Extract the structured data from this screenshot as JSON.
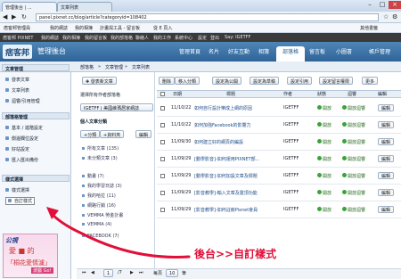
{
  "browser": {
    "tabs": [
      "管理後台 | ...",
      "文章列表"
    ],
    "url": "panel.pixnet.cc/blog/article?categoryid=108402",
    "bookmarks": [
      "痞客邦管理員",
      "我的網誌",
      "我的相簿",
      "計畫與工具 - 留言板",
      "從 E 頁入",
      "其他書籤"
    ]
  },
  "blogbar": {
    "items": [
      "痞客邦 PIXNET",
      "我的網誌",
      "我的相簿",
      "我的留言板",
      "我的部落格",
      "聯絡人",
      "我的工作",
      "系統中心",
      "設定",
      "登出",
      "Say: IGETFF"
    ]
  },
  "header": {
    "logo": "痞客邦",
    "subtitle": "管理後台",
    "tabs": [
      "管理首頁",
      "名片",
      "好友互動",
      "相簿",
      "部落格",
      "留言板",
      "小圖書",
      "帳戶管理"
    ],
    "active_tab": "部落格"
  },
  "breadcrumb": [
    "部落格",
    "文章管理",
    "文章列表"
  ],
  "sidebar": {
    "sections": [
      {
        "title": "文章管理",
        "items": [
          "發表文章",
          "文章列表",
          "迴響/引用管理"
        ]
      },
      {
        "title": "部落格管理",
        "items": [
          "基本 / 進階設定",
          "側邊欄位設定",
          "好站設定",
          "匯入匯出備份"
        ]
      },
      {
        "title": "樣式選擇",
        "items": [
          "樣式選擇",
          "自訂樣式"
        ]
      }
    ],
    "selected": "自訂樣式"
  },
  "ad": {
    "line1": "公視",
    "line2": "愛 ■ 的",
    "line3": "「桐花愛情濾」",
    "line4": "波戲 Go!"
  },
  "middle": {
    "new_button": "發表新文章",
    "select_label": "選擇所有作者部落格",
    "select_value": "IGETFF | 美國維瑪居家網誌",
    "cat_header": "個人文章分類",
    "add_button": "+分類",
    "folder_button": "+資料夾",
    "edit_button": "編輯",
    "categories": [
      "所有文章 (135)",
      "未分類文章 (3)",
      "動畫 (7)",
      "我的學習日誌 (3)",
      "我的哈拉 (11)",
      "網路行銷 (16)",
      "VEMMA 勞金計畫",
      "VEMMA (4)",
      "FACEBOOK (7)"
    ]
  },
  "toolbar": {
    "buttons": [
      "刪除",
      "移入分類",
      "設定為公開",
      "設定為草稿",
      "設定引用",
      "設定留言權限",
      "更多"
    ]
  },
  "table": {
    "headers": [
      "日期",
      "標題",
      "作者",
      "狀態",
      "迴響",
      "編輯"
    ],
    "rows": [
      {
        "date": "11/10/22",
        "title": "如何自行設計樂成上網的原因",
        "author": "IGETFF",
        "status": "開放",
        "reply": "開放迴響",
        "edit": "編輯"
      },
      {
        "date": "11/10/22",
        "title": "如何加強Facebook的影響力",
        "author": "IGETFF",
        "status": "開放",
        "reply": "開放迴響",
        "edit": "編輯"
      },
      {
        "date": "11/09/30",
        "title": "如何建立好的網頁的編設",
        "author": "IGETFF",
        "status": "開放",
        "reply": "開放迴響",
        "edit": "編輯"
      },
      {
        "date": "11/09/29",
        "title": "[動學影音]-如何運用PIXNET部...",
        "author": "IGETFF",
        "status": "開放",
        "reply": "開放迴響",
        "edit": "編輯"
      },
      {
        "date": "11/09/29",
        "title": "[動學影音]-如何加設文章及標題",
        "author": "IGETFF",
        "status": "開放",
        "reply": "開放迴響",
        "edit": "編輯"
      },
      {
        "date": "11/09/29",
        "title": "[影音教學]-輸入文章及置頂功能",
        "author": "IGETFF",
        "status": "開放",
        "reply": "開放迴響",
        "edit": "編輯"
      },
      {
        "date": "11/09/29",
        "title": "[影音教學]-如何註冊Pixnet會員",
        "author": "IGETFF",
        "status": "開放",
        "reply": "開放迴響",
        "edit": "編輯"
      }
    ]
  },
  "pager": {
    "page": "1",
    "total": "/7",
    "per_page_label": "每頁",
    "per_page": "10",
    "unit": "筆"
  },
  "annotation": "後台>>自訂樣式",
  "colors": {
    "accent": "#2f6498",
    "annotation": "#e0103a"
  }
}
